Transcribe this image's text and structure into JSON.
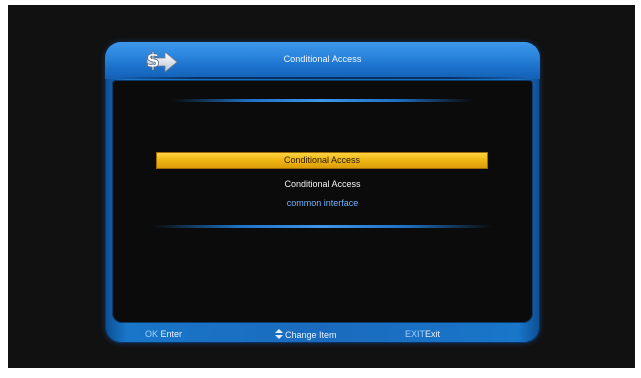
{
  "dialog": {
    "title": "Conditional Access"
  },
  "menu": {
    "selected_label": "Conditional Access",
    "items": [
      {
        "label": "Conditional Access"
      },
      {
        "label": "common interface"
      }
    ]
  },
  "footer": {
    "enter_key": "OK",
    "enter_label": "Enter",
    "change_label": "Change Item",
    "exit_key": "EXIT",
    "exit_label": "Exit"
  },
  "icons": {
    "logo": "dollar-arrow-logo-icon",
    "up_down": "up-down-arrows-icon"
  },
  "colors": {
    "frame_blue": "#1a6bbd",
    "highlight_yellow": "#f0b816",
    "text_white": "#f4f4f4",
    "text_light_blue": "#6fb2ff",
    "background": "#111111"
  }
}
